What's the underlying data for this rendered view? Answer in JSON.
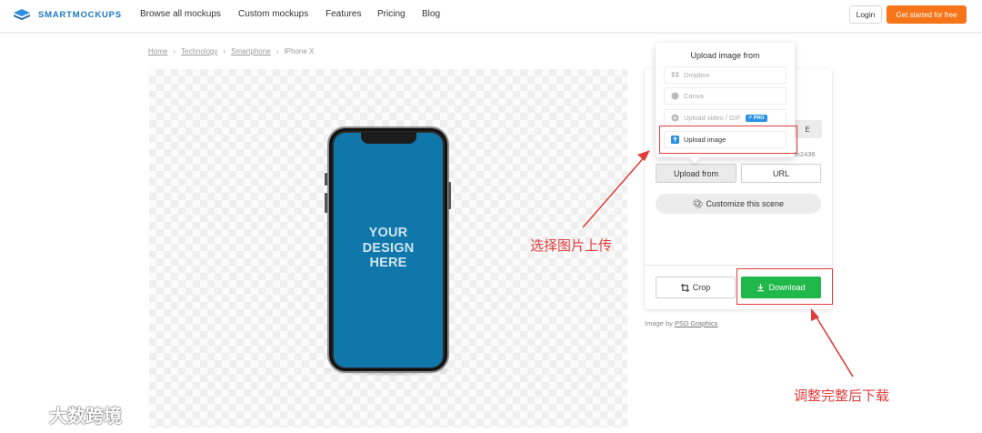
{
  "brand": {
    "name": "SMARTMOCKUPS"
  },
  "nav": {
    "links": [
      "Browse all mockups",
      "Custom mockups",
      "Features",
      "Pricing",
      "Blog"
    ],
    "login": "Login",
    "cta": "Get started for free"
  },
  "breadcrumb": {
    "items": [
      "Home",
      "Technology",
      "Smartphone",
      "IPhone X"
    ],
    "separator": "›"
  },
  "mockup": {
    "screen_text_lines": [
      "YOUR",
      "DESIGN",
      "HERE"
    ]
  },
  "upload_menu": {
    "title": "Upload image from",
    "items": [
      {
        "label": "Dropbox",
        "icon": "dropbox-icon",
        "enabled": false
      },
      {
        "label": "Canva",
        "icon": "canva-icon",
        "enabled": false
      },
      {
        "label": "Upload video / GIF",
        "icon": "video-icon",
        "enabled": false,
        "badge": "PRO"
      },
      {
        "label": "Upload image",
        "icon": "upload-image-icon",
        "enabled": true
      }
    ]
  },
  "panel": {
    "dimensions_text": "5x2436",
    "stub_label": "E",
    "upload_from_label": "Upload from",
    "url_label": "URL",
    "customize_label": "Customize this scene",
    "crop_label": "Crop",
    "download_label": "Download",
    "credit_prefix": "Image by",
    "credit_link": "PSD Graphics"
  },
  "annotations": {
    "upload_note": "选择图片上传",
    "download_note": "调整完整后下载"
  },
  "watermark": {
    "text": "大数跨境"
  },
  "colors": {
    "brand_blue": "#1e78c8",
    "cta_orange": "#f77418",
    "download_green": "#20b84a",
    "screen_blue": "#0f77a9",
    "annotation_red": "#e03c3c",
    "pro_badge_blue": "#2a92e6"
  }
}
